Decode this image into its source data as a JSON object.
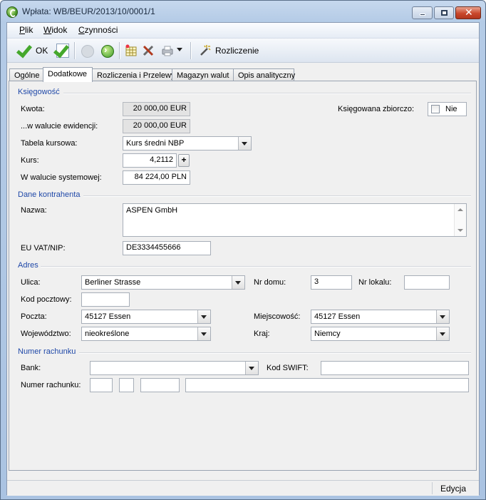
{
  "window": {
    "title": "Wpłata: WB/BEUR/2013/10/0001/1"
  },
  "menu": [
    {
      "label": "Plik",
      "underline": "P",
      "rest": "lik"
    },
    {
      "label": "Widok",
      "underline": "W",
      "rest": "idok"
    },
    {
      "label": "Czynności",
      "underline": "C",
      "rest": "zynności"
    }
  ],
  "toolbar": {
    "ok_label": "OK",
    "rozliczenie_label": "Rozliczenie"
  },
  "tabs": [
    "Ogólne",
    "Dodatkowe",
    "Rozliczenia i Przelewy",
    "Magazyn walut",
    "Opis analityczny"
  ],
  "active_tab": "Dodatkowe",
  "ksiegowosc": {
    "section": "Księgowość",
    "kwota_label": "Kwota:",
    "kwota_value": "20 000,00 EUR",
    "waluta_ewid_label": "...w walucie ewidencji:",
    "waluta_ewid_value": "20 000,00 EUR",
    "tabela_label": "Tabela kursowa:",
    "tabela_value": "Kurs średni NBP",
    "kurs_label": "Kurs:",
    "kurs_value": "4,2112",
    "kurs_plus": "+",
    "waluta_sys_label": "W walucie systemowej:",
    "waluta_sys_value": "84 224,00 PLN",
    "zbiorczo_label": "Księgowana zbiorczo:",
    "zbiorczo_value": "Nie"
  },
  "kontrahent": {
    "section": "Dane kontrahenta",
    "nazwa_label": "Nazwa:",
    "nazwa_value": "ASPEN GmbH",
    "vat_label": "EU VAT/NIP:",
    "vat_value": "DE3334455666"
  },
  "adres": {
    "section": "Adres",
    "ulica_label": "Ulica:",
    "ulica_value": "Berliner Strasse",
    "nr_domu_label": "Nr domu:",
    "nr_domu_value": "3",
    "nr_lokalu_label": "Nr lokalu:",
    "nr_lokalu_value": "",
    "kod_label": "Kod pocztowy:",
    "kod_value": "",
    "poczta_label": "Poczta:",
    "poczta_value": "45127 Essen",
    "miejscowosc_label": "Miejscowość:",
    "miejscowosc_value": "45127 Essen",
    "wojewodztwo_label": "Województwo:",
    "wojewodztwo_value": "nieokreślone",
    "kraj_label": "Kraj:",
    "kraj_value": "Niemcy"
  },
  "rachunek": {
    "section": "Numer rachunku",
    "bank_label": "Bank:",
    "bank_value": "",
    "swift_label": "Kod SWIFT:",
    "swift_value": "",
    "numer_label": "Numer rachunku:"
  },
  "status": {
    "mode": "Edycja"
  },
  "colors": {
    "section_heading": "#1f48a8",
    "ok_check": "#45a82c"
  }
}
